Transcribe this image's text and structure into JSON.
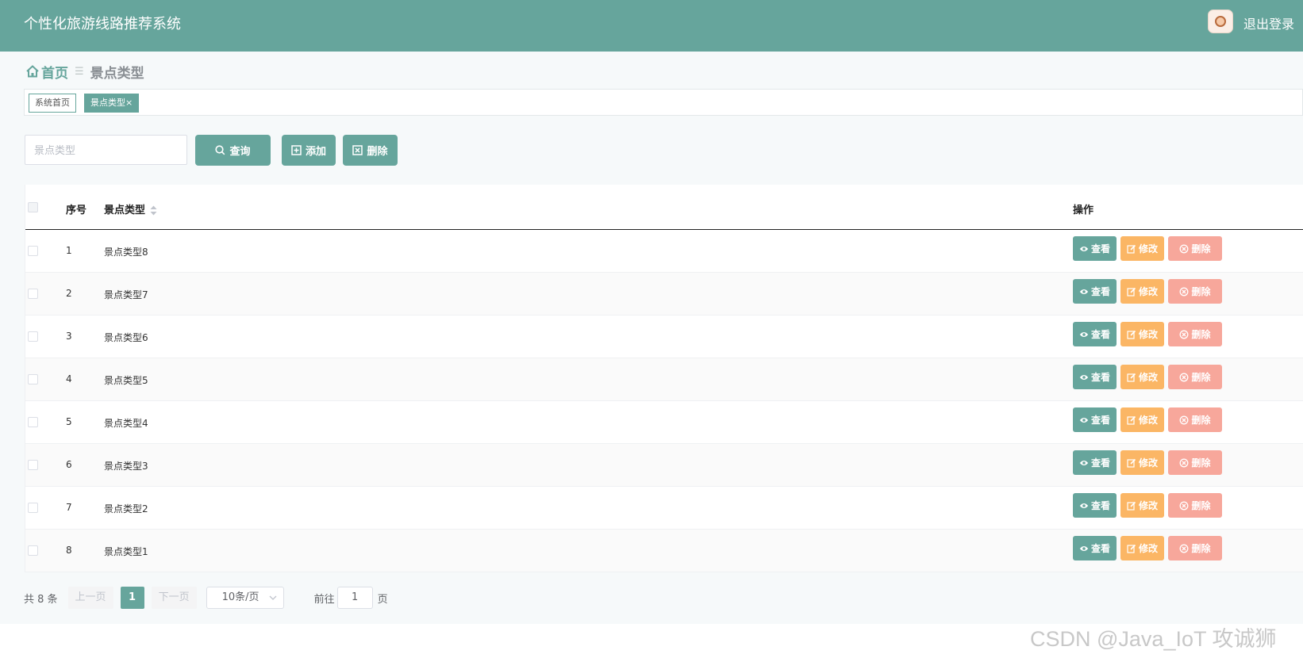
{
  "header": {
    "app_title": "个性化旅游线路推荐系统",
    "logout_label": "退出登录",
    "avatar_icon": "user-avatar-icon"
  },
  "breadcrumb": {
    "home_label": "首页",
    "current_label": "景点类型"
  },
  "tags": {
    "home_label": "系统首页",
    "active_label": "景点类型",
    "close_glyph": "×"
  },
  "toolbar": {
    "search_placeholder": "景点类型",
    "query_label": "查询",
    "add_label": "添加",
    "delete_label": "删除"
  },
  "table": {
    "columns": {
      "seq": "序号",
      "type": "景点类型",
      "ops": "操作"
    },
    "rows": [
      {
        "seq": "1",
        "type": "景点类型8"
      },
      {
        "seq": "2",
        "type": "景点类型7"
      },
      {
        "seq": "3",
        "type": "景点类型6"
      },
      {
        "seq": "4",
        "type": "景点类型5"
      },
      {
        "seq": "5",
        "type": "景点类型4"
      },
      {
        "seq": "6",
        "type": "景点类型3"
      },
      {
        "seq": "7",
        "type": "景点类型2"
      },
      {
        "seq": "8",
        "type": "景点类型1"
      }
    ],
    "row_actions": {
      "view_label": "查看",
      "edit_label": "修改",
      "delete_label": "删除"
    }
  },
  "pagination": {
    "total_text": "共 8 条",
    "prev_label": "上一页",
    "current_page": "1",
    "next_label": "下一页",
    "page_size": "10条/页",
    "goto_label": "前往",
    "goto_value": "1",
    "page_unit": "页"
  },
  "watermark": "CSDN @Java_IoT 攻诚狮",
  "colors": {
    "primary": "#66a59c",
    "edit": "#fbb665",
    "delete": "#f7a79b"
  }
}
